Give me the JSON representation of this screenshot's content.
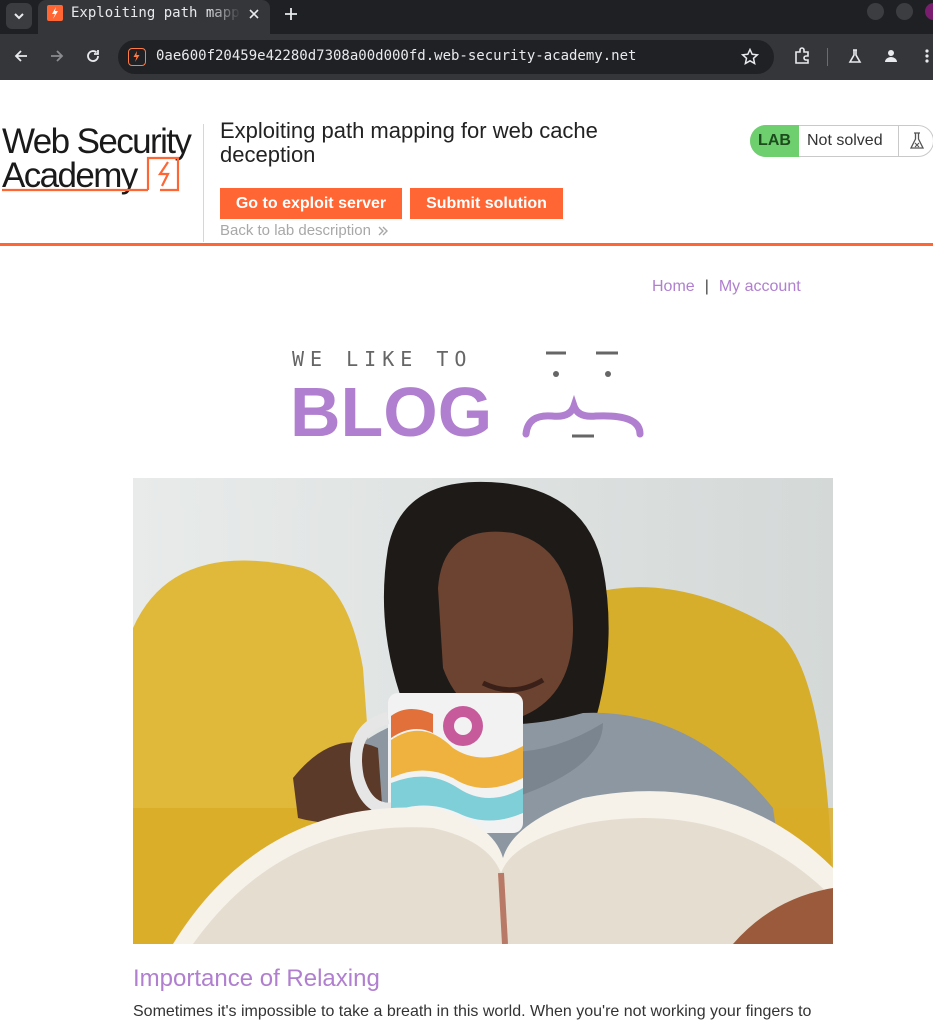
{
  "browser": {
    "tab_title": "Exploiting path mapping for web cache deception",
    "url": "0ae600f20459e42280d7308a00d000fd.web-security-academy.net",
    "icons": [
      "tab-search-icon",
      "close-icon",
      "plus-icon",
      "back-arrow-icon",
      "forward-arrow-icon",
      "reload-icon",
      "star-icon",
      "extensions-icon",
      "labs-flask-icon",
      "profile-icon",
      "kebab-menu-icon"
    ]
  },
  "lab": {
    "logo_line1": "Web Security",
    "logo_line2": "Academy",
    "title": "Exploiting path mapping for web cache deception",
    "exploit_button": "Go to exploit server",
    "submit_button": "Submit solution",
    "back_link": "Back to lab description",
    "badge": "LAB",
    "status": "Not solved",
    "accent_color": "#ff6633",
    "badge_color": "#6ecf6e"
  },
  "nav": {
    "home": "Home",
    "separator": "|",
    "account": "My account",
    "link_color": "#b07fcf"
  },
  "blog_logo": {
    "tagline": "WE LIKE TO",
    "word": "BLOG"
  },
  "post": {
    "image_subject": "woman holding colorful mug reading a book on a yellow sofa",
    "title": "Importance of Relaxing",
    "summary": "Sometimes it's impossible to take a breath in this world. When you're not working your fingers to"
  }
}
